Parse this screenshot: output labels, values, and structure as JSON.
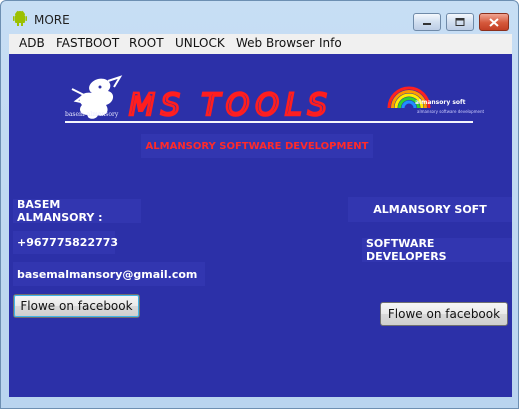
{
  "window": {
    "title": "MORE"
  },
  "menu": [
    "ADB",
    "FASTBOOT",
    "ROOT",
    "UNLOCK",
    "Web Browser",
    "Info"
  ],
  "logo": {
    "main_text": "MS TOOLS",
    "dragon_caption": "basem almansory",
    "brand": "almansory soft",
    "brand_sub": "almansory software development"
  },
  "content": {
    "center_label": "ALMANSORY SOFTWARE DEVELOPMENT",
    "name_label": "BASEM ALMANSORY :",
    "phone": "+967775822773",
    "email": "basemalmansory@gmail.com",
    "company": "ALMANSORY SOFT",
    "tagline": "SOFTWARE DEVELOPERS",
    "facebook_button_left": "Flowe on facebook",
    "facebook_button_right": "Flowe on facebook"
  },
  "colors": {
    "client_bg": "#2c30a8",
    "label_bg": "#3236b0",
    "accent_red": "#ff2a2a"
  }
}
